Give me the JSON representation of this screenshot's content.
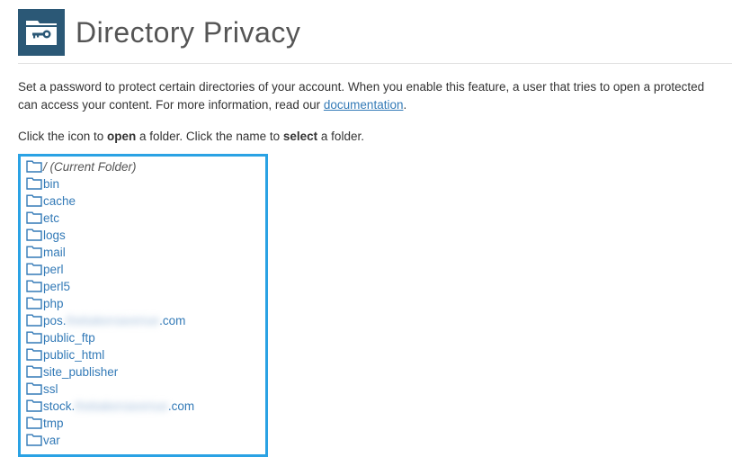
{
  "header": {
    "title": "Directory Privacy"
  },
  "intro": {
    "prefix": "Set a password to protect certain directories of your account. When you enable this feature, a user that tries to open a protected",
    "suffix": "can access your content. For more information, read our ",
    "doc_link": "documentation",
    "period": "."
  },
  "instr": {
    "p1": "Click the icon to ",
    "open": "open",
    "p2": " a folder. Click the name to ",
    "select": "select",
    "p3": " a folder."
  },
  "tree": {
    "items": [
      {
        "name": "/",
        "suffix": " (Current Folder)",
        "current": true
      },
      {
        "name": "bin"
      },
      {
        "name": "cache"
      },
      {
        "name": "etc"
      },
      {
        "name": "logs"
      },
      {
        "name": "mail"
      },
      {
        "name": "perl"
      },
      {
        "name": "perl5"
      },
      {
        "name": "php"
      },
      {
        "name": "pos.",
        "blurred_mid": "thebakersavenue",
        "tail": ".com"
      },
      {
        "name": "public_ftp"
      },
      {
        "name": "public_html"
      },
      {
        "name": "site_publisher"
      },
      {
        "name": "ssl"
      },
      {
        "name": "stock.",
        "blurred_mid": "thebakersavenue",
        "tail": ".com"
      },
      {
        "name": "tmp"
      },
      {
        "name": "var"
      }
    ]
  }
}
